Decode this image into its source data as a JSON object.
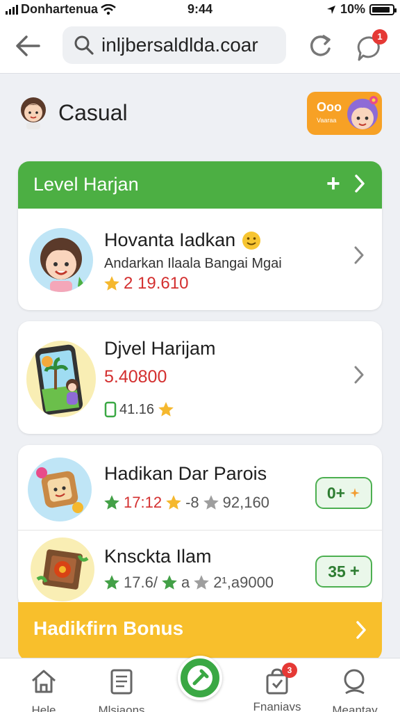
{
  "status_bar": {
    "carrier": "Donhartenua",
    "time": "9:44",
    "battery": "10%"
  },
  "browser": {
    "url": "inljbersaldlda.coar",
    "notification_count": "1"
  },
  "header": {
    "title": "Casual",
    "promo_top": "Ooo",
    "promo_bottom": "Vaaraa"
  },
  "level_panel": {
    "title": "Level Harjan",
    "item": {
      "title": "Hovanta Iadkan",
      "subtitle": "Andarkan Ilaala Bangai Mgai",
      "score": "2 19.610"
    }
  },
  "card2": {
    "title": "Djvel Harijam",
    "value": "5.40800",
    "stat": "41.16"
  },
  "card3": {
    "items": [
      {
        "title": "Hadikan Dar Parois",
        "stat_a": "17:12",
        "stat_b": "-8",
        "stat_c": "92,160",
        "badge": "0+"
      },
      {
        "title": "Knsckta Ilam",
        "stat_a": "17.6/",
        "stat_b": "a",
        "stat_c": "2¹,a9000",
        "badge": "35"
      }
    ]
  },
  "bonus": {
    "title": "Hadikfirn Bonus"
  },
  "tabbar": {
    "tabs": [
      {
        "label": "Hele"
      },
      {
        "label": "Mlsiaons"
      },
      {
        "label": "Fnaniavs",
        "badge": "3"
      },
      {
        "label": "Meantay"
      }
    ]
  },
  "colors": {
    "green": "#4caf43",
    "orange": "#f7a125",
    "yellow": "#f8bf2c",
    "red": "#e53935"
  }
}
